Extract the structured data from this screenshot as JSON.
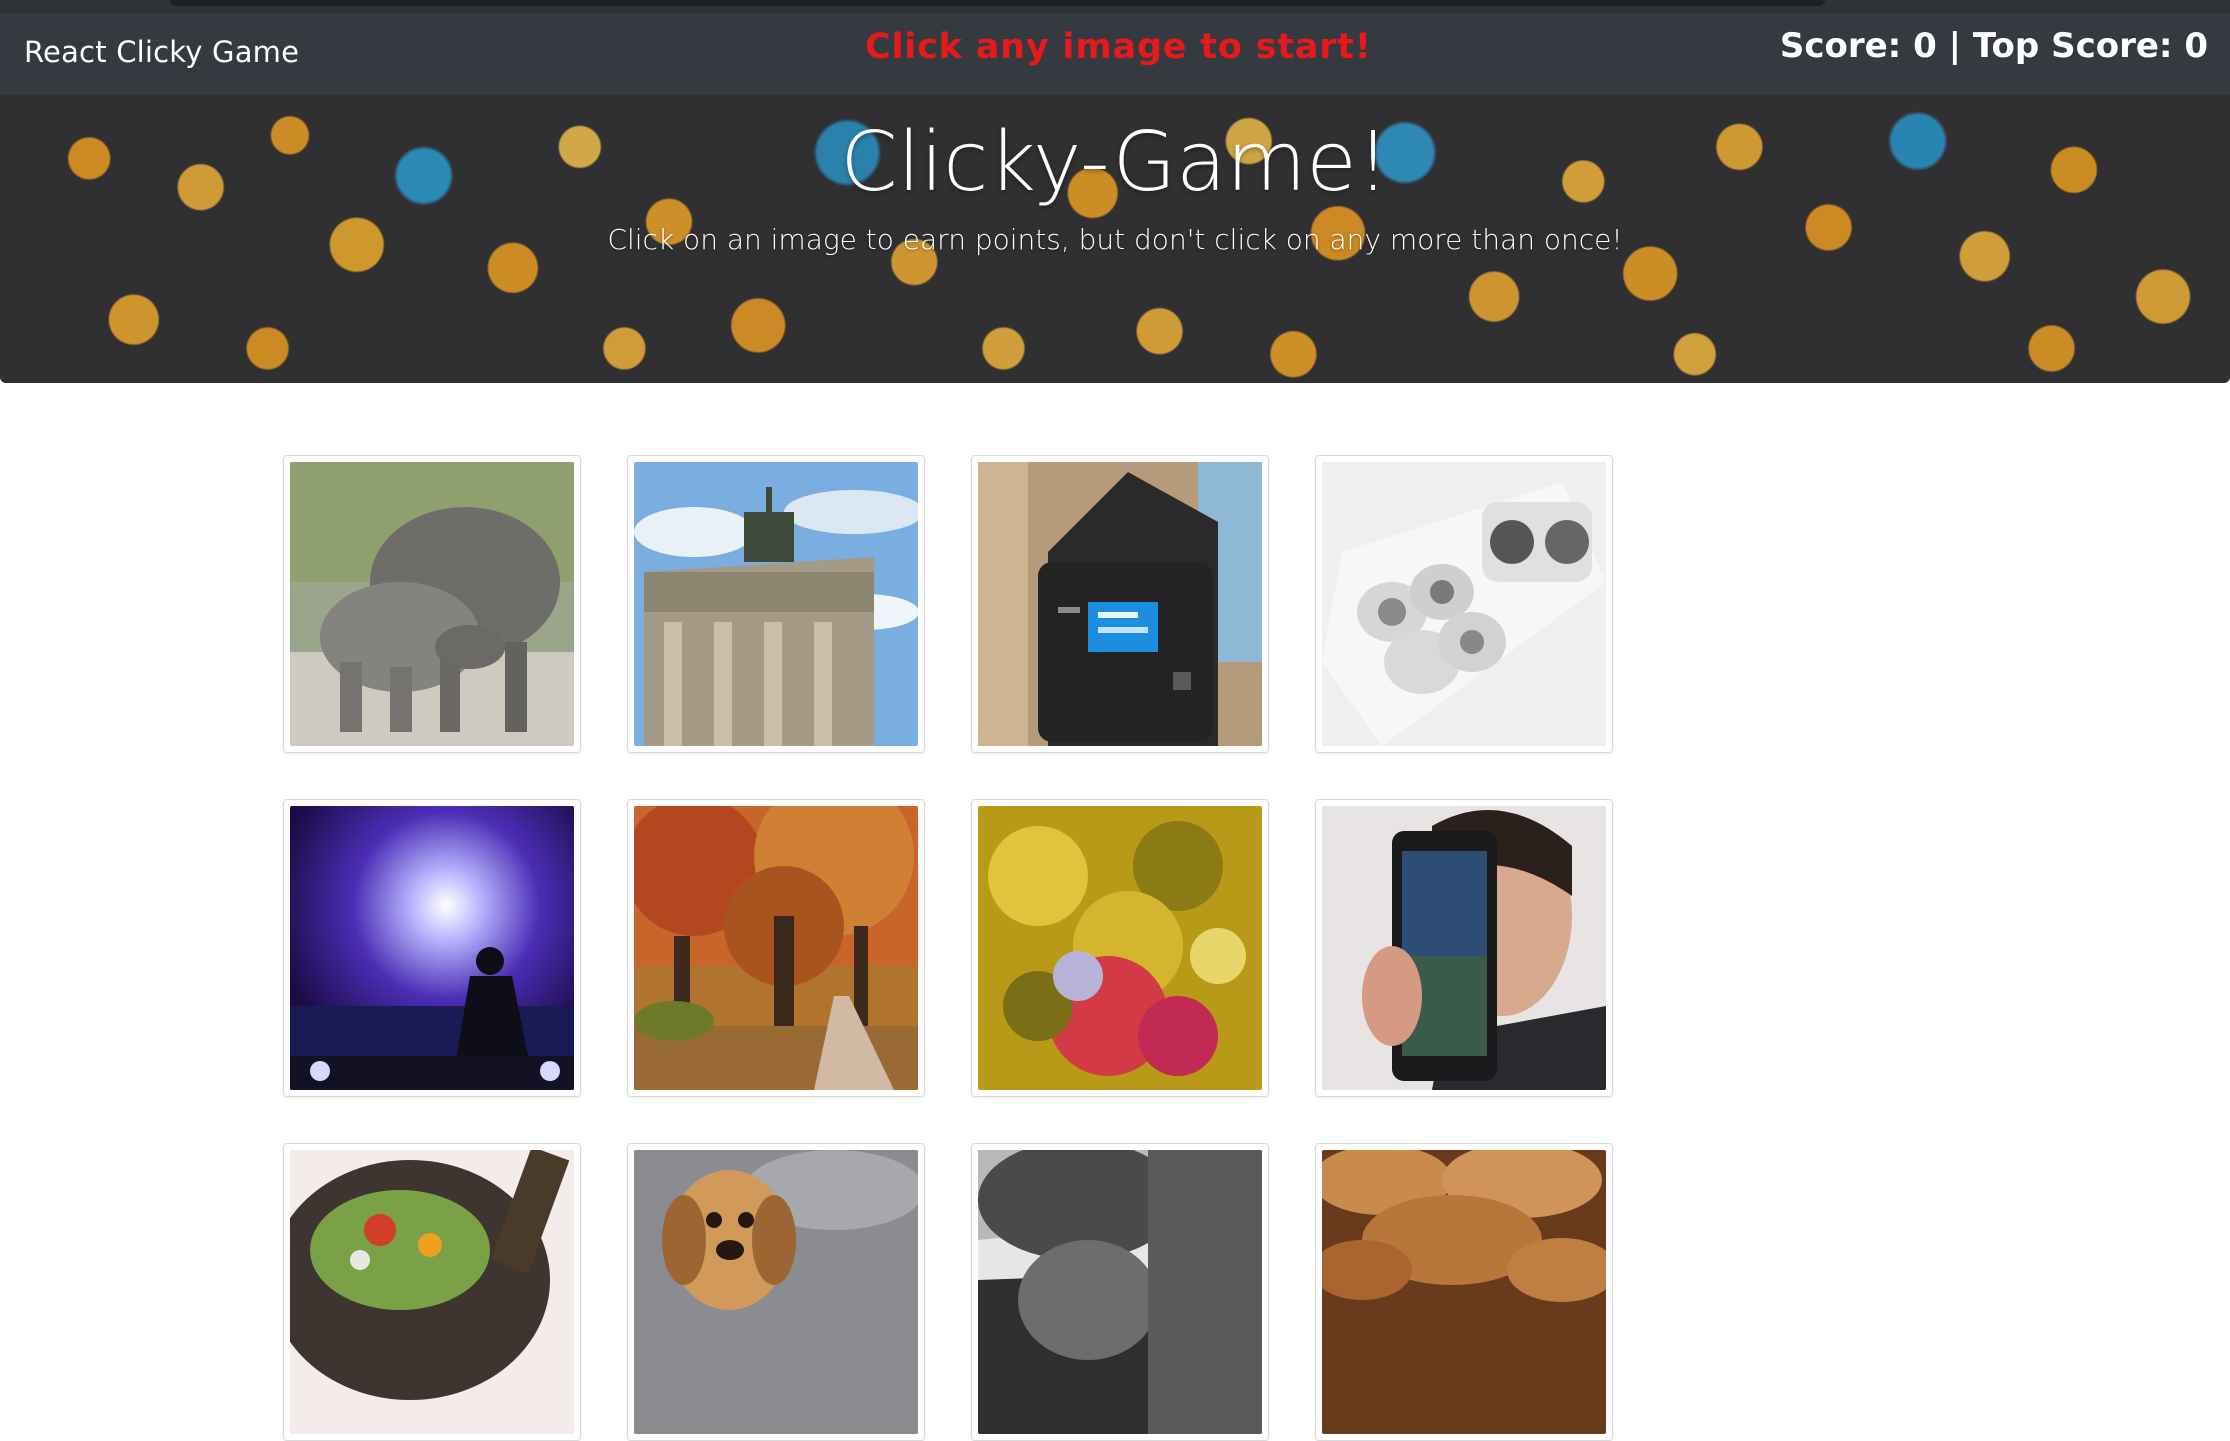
{
  "navbar": {
    "brand": "React Clicky Game",
    "status_message": "Click any image to start!",
    "score_text": "Score: 0 | Top Score: 0",
    "status_color": "#e8191b",
    "background": "#343a40"
  },
  "jumbotron": {
    "title": "Clicky-Game!",
    "subtitle": "Click on an image to earn points, but don't click on any more than once!"
  },
  "cards": [
    {
      "icon": "rhino-image"
    },
    {
      "icon": "brandenburg-gate-image"
    },
    {
      "icon": "mp3-player-image"
    },
    {
      "icon": "sushi-rolls-image"
    },
    {
      "icon": "dj-concert-image"
    },
    {
      "icon": "autumn-trees-image"
    },
    {
      "icon": "oil-water-abstract-image"
    },
    {
      "icon": "tablet-man-image"
    },
    {
      "icon": "wok-vegetables-image"
    },
    {
      "icon": "puppy-image"
    },
    {
      "icon": "helmet-bw-image"
    },
    {
      "icon": "bread-rolls-image"
    }
  ]
}
